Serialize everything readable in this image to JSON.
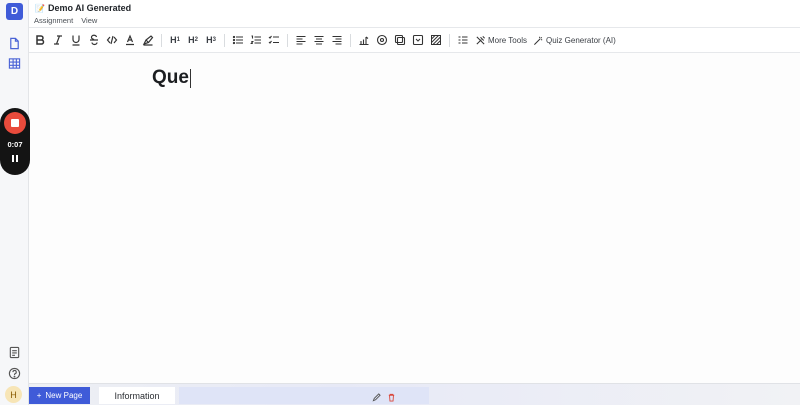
{
  "workspace": {
    "initial": "D",
    "accent": "#3f5bd8"
  },
  "document": {
    "emoji": "📝",
    "title": "Demo AI Generated",
    "menus": [
      "Assignment",
      "View"
    ]
  },
  "toolbar": {
    "buttons": [
      "bold-icon",
      "italic-icon",
      "underline-icon",
      "strikethrough-icon",
      "code-icon",
      "text-color-icon",
      "highlight-icon",
      "heading-1",
      "heading-2",
      "heading-3",
      "bullet-list-icon",
      "numbered-list-icon",
      "checklist-icon",
      "align-left-icon",
      "align-center-icon",
      "align-right-icon",
      "chart-icon",
      "target-icon",
      "copy-icon",
      "dropdown-icon",
      "pattern-icon",
      "format-icon"
    ],
    "h1": "H",
    "h2": "H",
    "h3": "H",
    "h1_sub": "1",
    "h2_sub": "2",
    "h3_sub": "3",
    "more_tools": "More Tools",
    "quiz_generator": "Quiz Generator (AI)"
  },
  "editor": {
    "heading_text": "Que"
  },
  "recorder": {
    "time": "0:07",
    "stop_color": "#e94b3c"
  },
  "user": {
    "initial": "H"
  },
  "pages": {
    "new_page_label": "New Page",
    "new_page_plus": "+",
    "tabs": [
      "Information"
    ]
  }
}
